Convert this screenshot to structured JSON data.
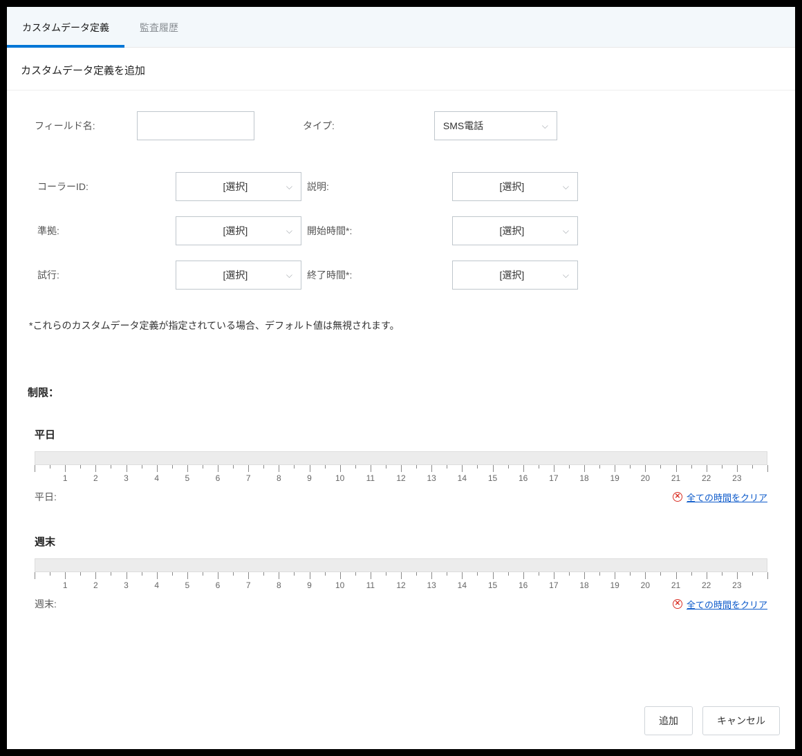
{
  "tabs": {
    "definitions": "カスタムデータ定義",
    "audit": "監査履歴"
  },
  "page_title": "カスタムデータ定義を追加",
  "form": {
    "field_name_label": "フィールド名:",
    "type_label": "タイプ:",
    "type_value": "SMS電話",
    "caller_id_label": "コーラーID:",
    "description_label": "説明:",
    "compliance_label": "準拠:",
    "start_time_label": "開始時間*:",
    "attempt_label": "試行:",
    "end_time_label": "終了時間*:",
    "select_placeholder": "[選択]"
  },
  "note": "*これらのカスタムデータ定義が指定されている場合、デフォルト値は無視されます。",
  "restrictions_title": "制限：",
  "schedules": {
    "weekday_heading": "平日",
    "weekday_footer_label": "平日:",
    "weekend_heading": "週末",
    "weekend_footer_label": "週末:",
    "clear_all": "全ての時間をクリア",
    "hours": [
      "1",
      "2",
      "3",
      "4",
      "5",
      "6",
      "7",
      "8",
      "9",
      "10",
      "11",
      "12",
      "13",
      "14",
      "15",
      "16",
      "17",
      "18",
      "19",
      "20",
      "21",
      "22",
      "23"
    ]
  },
  "buttons": {
    "add": "追加",
    "cancel": "キャンセル"
  }
}
